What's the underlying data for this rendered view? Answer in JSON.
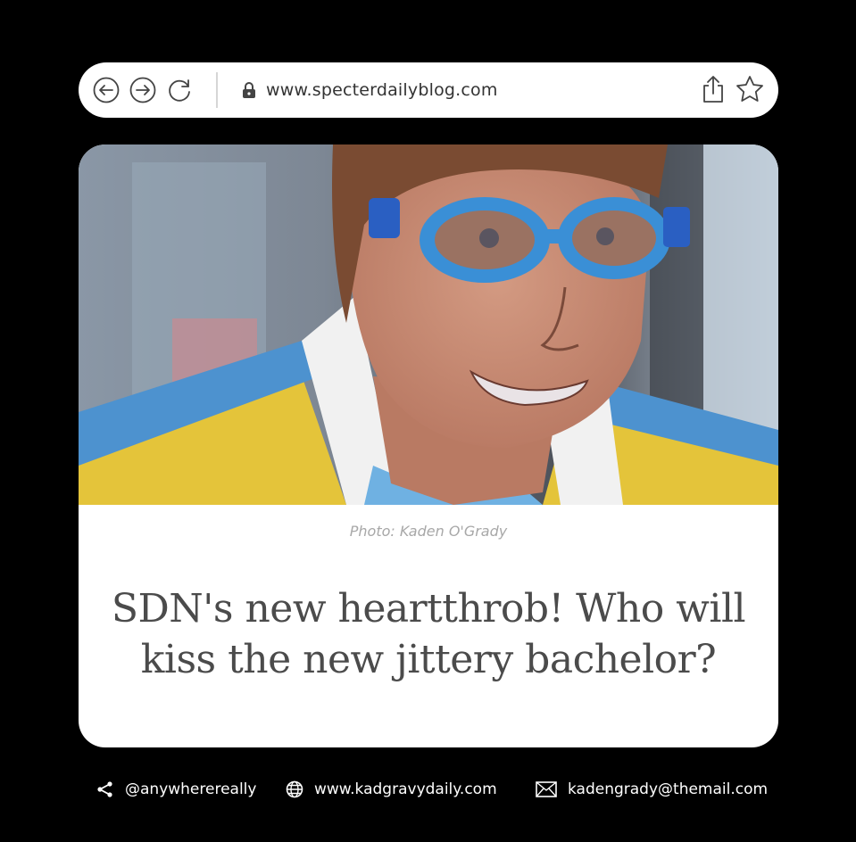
{
  "browser": {
    "url": "www.specterdailyblog.com",
    "icons": [
      "back-arrow-icon",
      "forward-arrow-icon",
      "reload-icon",
      "lock-icon",
      "share-icon",
      "star-icon"
    ]
  },
  "article": {
    "photo_alt": "Animated man with blue swim goggles smiling",
    "caption": "Photo: Kaden O'Grady",
    "headline_line1": "SDN's new heartthrob! Who will",
    "headline_line2": "kiss the new jittery bachelor?"
  },
  "footer": {
    "social_handle": "@anywherereally",
    "website": "www.kadgravydaily.com",
    "email": "kadengrady@themail.com"
  },
  "colors": {
    "background": "#000000",
    "card": "#ffffff",
    "headline": "#4b4b4b",
    "caption": "#a8a8a8",
    "goggles": "#3a8fd6"
  }
}
